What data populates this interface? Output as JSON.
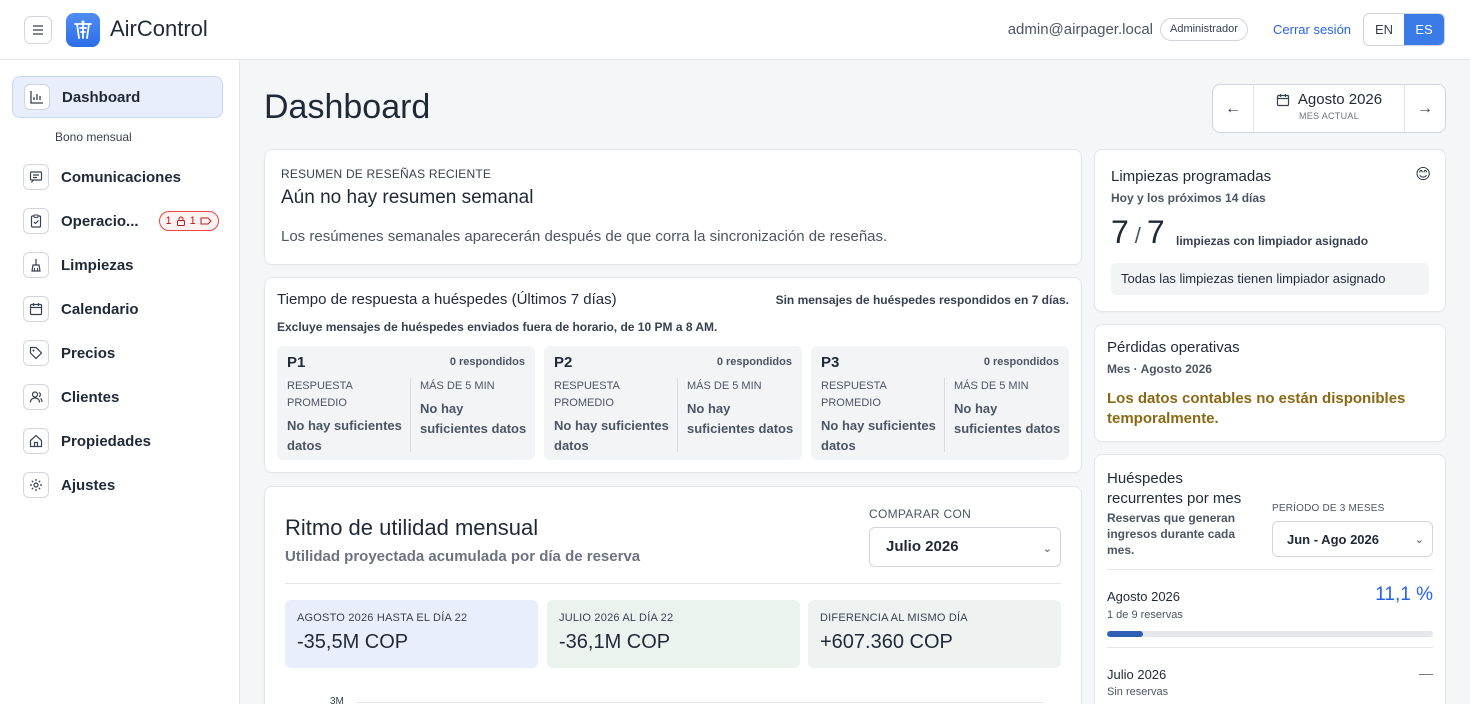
{
  "app": {
    "brand": "AirControl",
    "user_email": "admin@airpager.local",
    "role": "Administrador",
    "logout": "Cerrar sesión",
    "lang_en": "EN",
    "lang_es": "ES"
  },
  "sidebar": {
    "dashboard": "Dashboard",
    "bono": "Bono mensual",
    "comunicaciones": "Comunicaciones",
    "operaciones": "Operacio...",
    "operaciones_badge_a": "1",
    "operaciones_badge_b": "1",
    "limpiezas": "Limpiezas",
    "calendario": "Calendario",
    "precios": "Precios",
    "clientes": "Clientes",
    "propiedades": "Propiedades",
    "ajustes": "Ajustes"
  },
  "main": {
    "title": "Dashboard",
    "month": "Agosto 2026",
    "month_sub": "MES ACTUAL"
  },
  "reviews": {
    "kicker": "RESUMEN DE RESEÑAS RECIENTE",
    "title": "Aún no hay resumen semanal",
    "text": "Los resúmenes semanales aparecerán después de que corra la sincronización de reseñas."
  },
  "response": {
    "title": "Tiempo de respuesta a huéspedes (Últimos 7 días)",
    "note": "Sin mensajes de huéspedes respondidos en 7 días.",
    "sub": "Excluye mensajes de huéspedes enviados fuera de horario, de 10 PM a 8 AM.",
    "boxes": [
      {
        "name": "P1",
        "count": "0 respondidos",
        "avg_label": "RESPUESTA PROMEDIO",
        "avg_value": "No hay suficientes datos",
        "over_label": "MÁS DE 5 MIN",
        "over_value": "No hay suficientes datos"
      },
      {
        "name": "P2",
        "count": "0 respondidos",
        "avg_label": "RESPUESTA PROMEDIO",
        "avg_value": "No hay suficientes datos",
        "over_label": "MÁS DE 5 MIN",
        "over_value": "No hay suficientes datos"
      },
      {
        "name": "P3",
        "count": "0 respondidos",
        "avg_label": "RESPUESTA PROMEDIO",
        "avg_value": "No hay suficientes datos",
        "over_label": "MÁS DE 5 MIN",
        "over_value": "No hay suficientes datos"
      }
    ]
  },
  "profit": {
    "title": "Ritmo de utilidad mensual",
    "sub": "Utilidad proyectada acumulada por día de reserva",
    "compare_label": "COMPARAR CON",
    "compare_value": "Julio 2026",
    "stats": [
      {
        "label": "AGOSTO 2026 HASTA EL DÍA 22",
        "value": "-35,5M COP",
        "bg": "#e8eefb"
      },
      {
        "label": "JULIO 2026 AL DÍA 22",
        "value": "-36,1M COP",
        "bg": "#eaf3ee"
      },
      {
        "label": "DIFERENCIA AL MISMO DÍA",
        "value": "+607.360 COP",
        "bg": "#eef3f2"
      }
    ],
    "axis_tick": "3M"
  },
  "cleanings": {
    "title": "Limpiezas programadas",
    "sub": "Hoy y los próximos 14 días",
    "num_a": "7",
    "slash": "/",
    "num_b": "7",
    "num_label": "limpiezas con limpiador asignado",
    "all_ok": "Todas las limpiezas tienen limpiador asignado",
    "emoji": "😊"
  },
  "losses": {
    "title": "Pérdidas operativas",
    "sub": "Mes · Agosto 2026",
    "warn": "Los datos contables no están disponibles temporalmente."
  },
  "recurring": {
    "title": "Huéspedes recurrentes por mes",
    "sub": "Reservas que generan ingresos durante cada mes.",
    "period_label": "PERÍODO DE 3 MESES",
    "period_value": "Jun - Ago 2026",
    "row1_title": "Agosto 2026",
    "row1_sub": "1 de 9 reservas",
    "row1_pct": "11,1 %",
    "row1_progress": 0.111,
    "row2_title": "Julio 2026",
    "row2_sub": "Sin reservas",
    "row2_value": "—"
  }
}
